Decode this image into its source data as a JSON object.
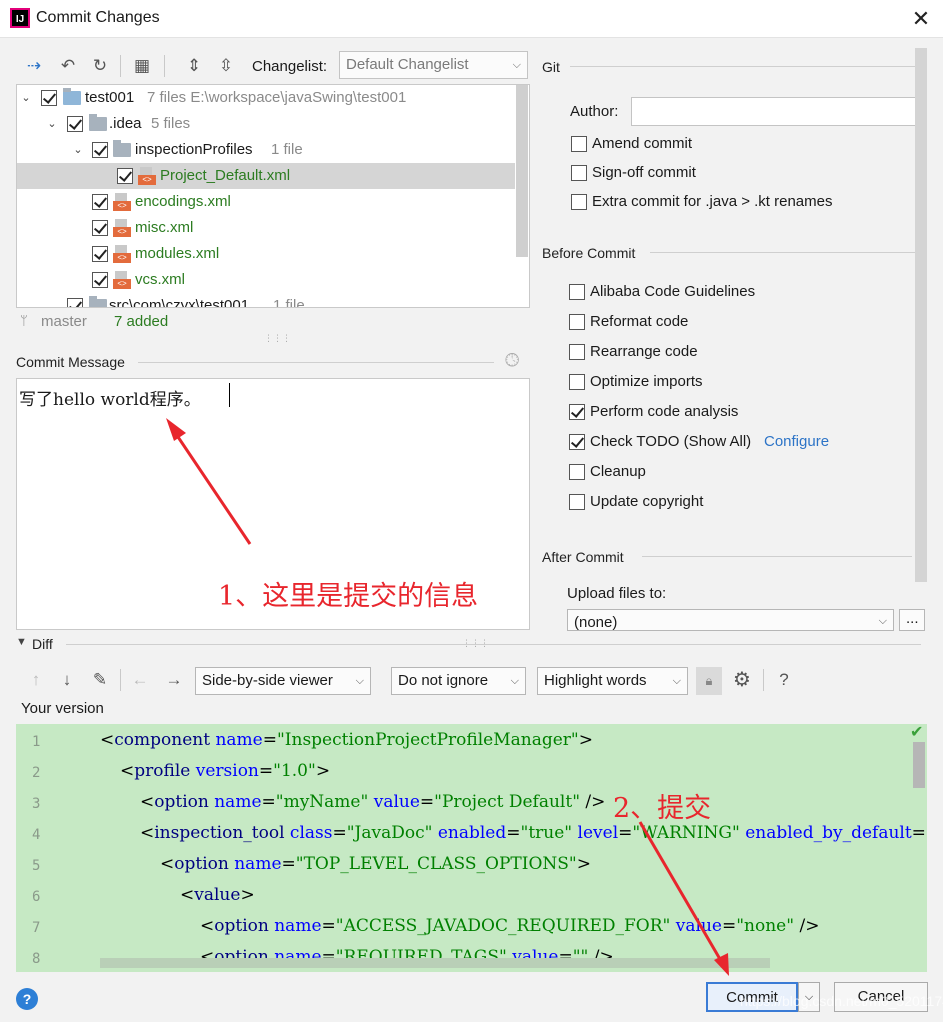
{
  "window": {
    "title": "Commit Changes",
    "app_icon_text": "IJ",
    "close": "✕"
  },
  "toolbar": {
    "changelist_label": "Changelist:",
    "changelist_value": "Default Changelist"
  },
  "tree": {
    "rows": [
      {
        "name": "test001",
        "meta": "7 files  E:\\workspace\\javaSwing\\test001"
      },
      {
        "name": ".idea",
        "meta": "5 files"
      },
      {
        "name": "inspectionProfiles",
        "meta": "1 file"
      },
      {
        "name": "Project_Default.xml",
        "meta": ""
      },
      {
        "name": "encodings.xml",
        "meta": ""
      },
      {
        "name": "misc.xml",
        "meta": ""
      },
      {
        "name": "modules.xml",
        "meta": ""
      },
      {
        "name": "vcs.xml",
        "meta": ""
      },
      {
        "name": "src\\com\\czyx\\test001",
        "meta": "1 file"
      }
    ]
  },
  "status": {
    "branch": "master",
    "added": "7 added"
  },
  "commit_message": {
    "label": "Commit Message",
    "text": "写了hello world程序。"
  },
  "annotations": {
    "one": "1、这里是提交的信息",
    "two": "2、提交"
  },
  "git": {
    "section": "Git",
    "author_label": "Author:",
    "author_value": "",
    "options": [
      {
        "label": "Amend commit",
        "checked": false
      },
      {
        "label": "Sign-off commit",
        "checked": false
      },
      {
        "label": "Extra commit for .java > .kt renames",
        "checked": false
      }
    ]
  },
  "before_commit": {
    "section": "Before Commit",
    "options": [
      {
        "label": "Alibaba Code Guidelines",
        "checked": false
      },
      {
        "label": "Reformat code",
        "checked": false
      },
      {
        "label": "Rearrange code",
        "checked": false
      },
      {
        "label": "Optimize imports",
        "checked": false
      },
      {
        "label": "Perform code analysis",
        "checked": true
      },
      {
        "label": "Check TODO (Show All)",
        "checked": true
      },
      {
        "label": "Cleanup",
        "checked": false
      },
      {
        "label": "Update copyright",
        "checked": false
      }
    ],
    "configure_link": "Configure"
  },
  "after_commit": {
    "section": "After Commit",
    "upload_label": "Upload files to:",
    "upload_value": "(none)",
    "browse": "..."
  },
  "diff": {
    "section": "Diff",
    "viewer": "Side-by-side viewer",
    "ignore": "Do not ignore",
    "highlight": "Highlight words",
    "help": "?",
    "your_version": "Your version",
    "line_numbers": [
      "1",
      "2",
      "3",
      "4",
      "5",
      "6",
      "7",
      "8"
    ]
  },
  "buttons": {
    "commit": "Commit",
    "cancel": "Cancel",
    "help": "?"
  },
  "watermark": "https://blog.csdn.net/m0_52011747"
}
